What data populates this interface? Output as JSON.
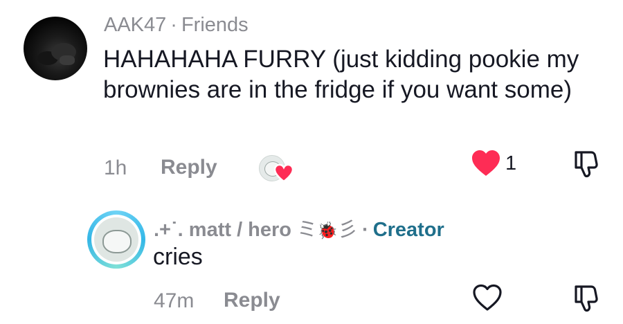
{
  "comments": [
    {
      "username": "AAK47",
      "relation": "Friends",
      "text": "HAHAHAHA FURRY (just kidding pookie my brownies are in the fridge if you want some)",
      "time": "1h",
      "reply_label": "Reply",
      "like_count": "1",
      "liked": true,
      "accent_color": "#fe2c55"
    },
    {
      "username_prefix": ".+˙.",
      "username": "matt / hero",
      "username_suffix_left": "ミ",
      "username_emoji": "🐞",
      "username_suffix_right": "彡",
      "role": "Creator",
      "text": "cries",
      "time": "47m",
      "reply_label": "Reply",
      "liked": false,
      "role_color": "#1f6f8b"
    }
  ],
  "separator": "·",
  "icons": {
    "like_filled": "heart-filled-icon",
    "like_outline": "heart-outline-icon",
    "dislike": "thumbs-down-icon",
    "creator_liked": "creator-liked-heart-icon"
  }
}
